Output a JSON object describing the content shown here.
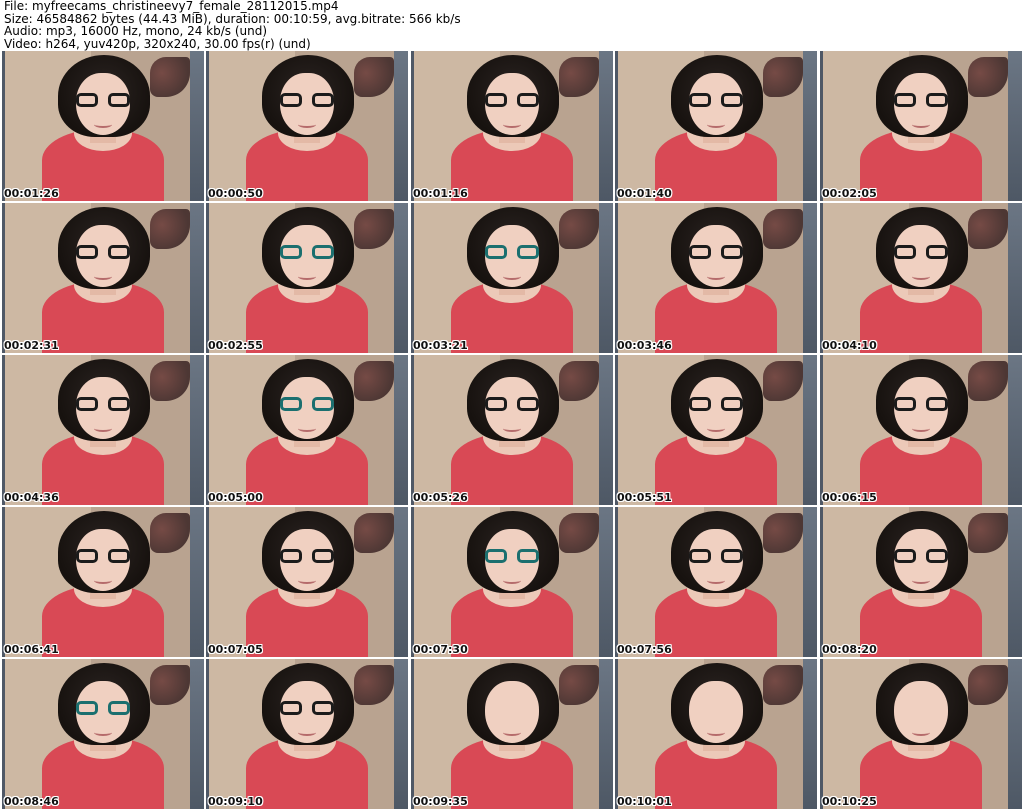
{
  "header": {
    "file_line": "File: myfreecams_christineevy7_female_28112015.mp4",
    "size_line": "Size: 46584862 bytes (44.43 MiB), duration: 00:10:59, avg.bitrate: 566 kb/s",
    "audio_line": "Audio: mp3, 16000 Hz, mono, 24 kb/s (und)",
    "video_line": "Video: h264, yuv420p, 320x240, 30.00 fps(r) (und)"
  },
  "thumbnails": [
    {
      "timestamp": "00:01:26",
      "glasses": "black"
    },
    {
      "timestamp": "00:00:50",
      "glasses": "black"
    },
    {
      "timestamp": "00:01:16",
      "glasses": "black"
    },
    {
      "timestamp": "00:01:40",
      "glasses": "black"
    },
    {
      "timestamp": "00:02:05",
      "glasses": "black"
    },
    {
      "timestamp": "00:02:31",
      "glasses": "black"
    },
    {
      "timestamp": "00:02:55",
      "glasses": "teal"
    },
    {
      "timestamp": "00:03:21",
      "glasses": "teal"
    },
    {
      "timestamp": "00:03:46",
      "glasses": "black"
    },
    {
      "timestamp": "00:04:10",
      "glasses": "black"
    },
    {
      "timestamp": "00:04:36",
      "glasses": "black"
    },
    {
      "timestamp": "00:05:00",
      "glasses": "teal"
    },
    {
      "timestamp": "00:05:26",
      "glasses": "black"
    },
    {
      "timestamp": "00:05:51",
      "glasses": "black"
    },
    {
      "timestamp": "00:06:15",
      "glasses": "black"
    },
    {
      "timestamp": "00:06:41",
      "glasses": "black"
    },
    {
      "timestamp": "00:07:05",
      "glasses": "black"
    },
    {
      "timestamp": "00:07:30",
      "glasses": "teal"
    },
    {
      "timestamp": "00:07:56",
      "glasses": "black"
    },
    {
      "timestamp": "00:08:20",
      "glasses": "black"
    },
    {
      "timestamp": "00:08:46",
      "glasses": "teal"
    },
    {
      "timestamp": "00:09:10",
      "glasses": "black"
    },
    {
      "timestamp": "00:09:35",
      "glasses": "none"
    },
    {
      "timestamp": "00:10:01",
      "glasses": "none"
    },
    {
      "timestamp": "00:10:25",
      "glasses": "none"
    }
  ]
}
